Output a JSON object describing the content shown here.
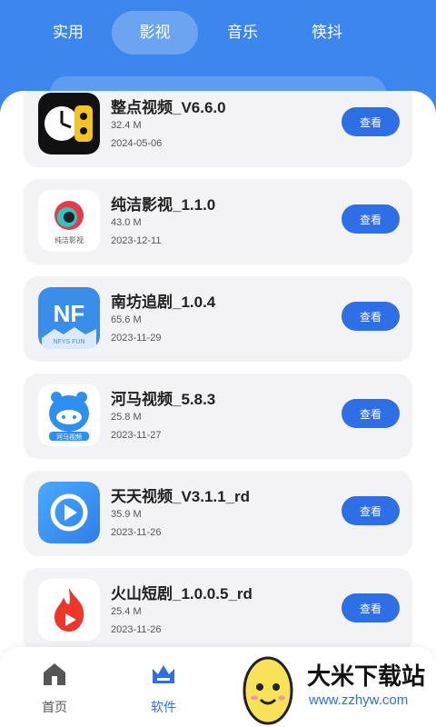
{
  "tabs": [
    {
      "label": "实用"
    },
    {
      "label": "影视"
    },
    {
      "label": "音乐"
    },
    {
      "label": "筷抖"
    }
  ],
  "view_label": "查看",
  "apps": [
    {
      "name": "整点视频_V6.6.0",
      "size": "32.4 M",
      "date": "2024-05-06",
      "icon": "clock-film-icon"
    },
    {
      "name": "纯洁影视_1.1.0",
      "size": "43.0 M",
      "date": "2023-12-11",
      "icon": "lens-logo-icon",
      "icon_text": "纯洁影视"
    },
    {
      "name": "南坊追剧_1.0.4",
      "size": "65.6 M",
      "date": "2023-11-29",
      "icon": "nf-logo-icon",
      "icon_text": "NF",
      "icon_subtext": "NFYS FUN"
    },
    {
      "name": "河马视频_5.8.3",
      "size": "25.8 M",
      "date": "2023-11-27",
      "icon": "hippo-icon",
      "icon_text": "河马视频"
    },
    {
      "name": "天天视频_V3.1.1_rd",
      "size": "35.9 M",
      "date": "2023-11-26",
      "icon": "play-icon"
    },
    {
      "name": "火山短剧_1.0.0.5_rd",
      "size": "25.4 M",
      "date": "2023-11-26",
      "icon": "flame-play-icon"
    }
  ],
  "nav": [
    {
      "label": "首页",
      "icon": "home-icon"
    },
    {
      "label": "软件",
      "icon": "crown-icon"
    }
  ],
  "watermark": {
    "title": "大米下载站",
    "url": "www.zzhyw.com"
  },
  "colors": {
    "header": "#3c86ee",
    "button": "#2f6fe6",
    "card": "#f3f3f5"
  }
}
